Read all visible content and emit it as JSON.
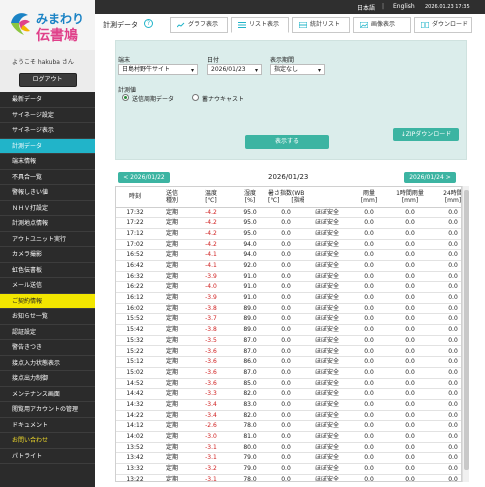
{
  "topbar": {
    "lang_ja": "日本語",
    "sep": "|",
    "lang_en": "English",
    "datetime": "2026.01.23 17:35"
  },
  "logo": {
    "line1": "みまわり",
    "line2": "伝書鳩"
  },
  "user": {
    "welcome": "ようこそ hakuba さん",
    "logout": "ログアウト"
  },
  "menu": [
    {
      "label": "最新データ",
      "state": ""
    },
    {
      "label": "サイネージ設定",
      "state": ""
    },
    {
      "label": "サイネージ表示",
      "state": ""
    },
    {
      "label": "計測データ",
      "state": "active"
    },
    {
      "label": "端末情報",
      "state": ""
    },
    {
      "label": "不具合一覧",
      "state": ""
    },
    {
      "label": "警報しきい値",
      "state": ""
    },
    {
      "label": "ＮＨＶ打設定",
      "state": ""
    },
    {
      "label": "計測地点情報",
      "state": ""
    },
    {
      "label": "アウトユニット実行",
      "state": ""
    },
    {
      "label": "カメラ撮影",
      "state": ""
    },
    {
      "label": "虹色伝書板",
      "state": ""
    },
    {
      "label": "メール送信",
      "state": ""
    },
    {
      "label": "ご契約情報",
      "state": "hl"
    },
    {
      "label": "お知らせ一覧",
      "state": ""
    },
    {
      "label": "認証設定",
      "state": ""
    },
    {
      "label": "警告きつき",
      "state": ""
    },
    {
      "label": "接点入力状態表示",
      "state": ""
    },
    {
      "label": "接点出力制御",
      "state": ""
    },
    {
      "label": "メンテナンス画面",
      "state": ""
    },
    {
      "label": "閲覧用アカウントの管理",
      "state": ""
    },
    {
      "label": "ドキュメント",
      "state": ""
    },
    {
      "label": "お問い合わせ",
      "state": "footer"
    },
    {
      "label": "パトライト",
      "state": ""
    }
  ],
  "page": {
    "title": "計測データ",
    "help": "?"
  },
  "tabs": [
    {
      "label": "グラフ表示",
      "icon": "chart-icon"
    },
    {
      "label": "リスト表示",
      "icon": "list-icon"
    },
    {
      "label": "統計リスト",
      "icon": "stats-icon"
    },
    {
      "label": "画像表示",
      "icon": "image-icon"
    },
    {
      "label": "ダウンロード",
      "icon": "download-icon"
    }
  ],
  "filters": {
    "device_label": "端末",
    "device_value": "日島村野牛サイト",
    "date_label": "日付",
    "date_value": "2026/01/23",
    "period_label": "表示期間",
    "period_value": "指定なし",
    "method_label": "計測値",
    "method_opt1": "送信周期データ",
    "method_opt2": "蓄ナウキャスト",
    "show_button": "表示する",
    "zip_button": "↓ZIPダウンロード"
  },
  "nav": {
    "prev": "< 2026/01/22",
    "current": "2026/01/23",
    "next": "2026/01/24 >"
  },
  "table": {
    "headers": [
      [
        "時刻"
      ],
      [
        "送信",
        "種別"
      ],
      [
        "温度",
        "[℃]"
      ],
      [
        "湿度",
        "[%]"
      ],
      [
        "暑さ指数(WBGT)",
        "[℃]　　[指標]"
      ],
      [
        "",
        ""
      ],
      [
        "雨量",
        "[mm]"
      ],
      [
        "1時間雨量",
        "[mm]"
      ],
      [
        "24時間",
        "[mm]"
      ]
    ],
    "rows": [
      [
        "17:32",
        "定期",
        "-4.2",
        "95.0",
        "0.0",
        "ほぼ安全",
        "0.0",
        "0.0",
        "0.0"
      ],
      [
        "17:22",
        "定期",
        "-4.2",
        "95.0",
        "0.0",
        "ほぼ安全",
        "0.0",
        "0.0",
        "0.0"
      ],
      [
        "17:12",
        "定期",
        "-4.2",
        "95.0",
        "0.0",
        "ほぼ安全",
        "0.0",
        "0.0",
        "0.0"
      ],
      [
        "17:02",
        "定期",
        "-4.2",
        "94.0",
        "0.0",
        "ほぼ安全",
        "0.0",
        "0.0",
        "0.0"
      ],
      [
        "16:52",
        "定期",
        "-4.1",
        "94.0",
        "0.0",
        "ほぼ安全",
        "0.0",
        "0.0",
        "0.0"
      ],
      [
        "16:42",
        "定期",
        "-4.1",
        "92.0",
        "0.0",
        "ほぼ安全",
        "0.0",
        "0.0",
        "0.0"
      ],
      [
        "16:32",
        "定期",
        "-3.9",
        "91.0",
        "0.0",
        "ほぼ安全",
        "0.0",
        "0.0",
        "0.0"
      ],
      [
        "16:22",
        "定期",
        "-4.0",
        "91.0",
        "0.0",
        "ほぼ安全",
        "0.0",
        "0.0",
        "0.0"
      ],
      [
        "16:12",
        "定期",
        "-3.9",
        "91.0",
        "0.0",
        "ほぼ安全",
        "0.0",
        "0.0",
        "0.0"
      ],
      [
        "16:02",
        "定期",
        "-3.8",
        "89.0",
        "0.0",
        "ほぼ安全",
        "0.0",
        "0.0",
        "0.0"
      ],
      [
        "15:52",
        "定期",
        "-3.7",
        "89.0",
        "0.0",
        "ほぼ安全",
        "0.0",
        "0.0",
        "0.0"
      ],
      [
        "15:42",
        "定期",
        "-3.8",
        "89.0",
        "0.0",
        "ほぼ安全",
        "0.0",
        "0.0",
        "0.0"
      ],
      [
        "15:32",
        "定期",
        "-3.5",
        "87.0",
        "0.0",
        "ほぼ安全",
        "0.0",
        "0.0",
        "0.0"
      ],
      [
        "15:22",
        "定期",
        "-3.6",
        "87.0",
        "0.0",
        "ほぼ安全",
        "0.0",
        "0.0",
        "0.0"
      ],
      [
        "15:12",
        "定期",
        "-3.6",
        "86.0",
        "0.0",
        "ほぼ安全",
        "0.0",
        "0.0",
        "0.0"
      ],
      [
        "15:02",
        "定期",
        "-3.6",
        "87.0",
        "0.0",
        "ほぼ安全",
        "0.0",
        "0.0",
        "0.0"
      ],
      [
        "14:52",
        "定期",
        "-3.6",
        "85.0",
        "0.0",
        "ほぼ安全",
        "0.0",
        "0.0",
        "0.0"
      ],
      [
        "14:42",
        "定期",
        "-3.3",
        "82.0",
        "0.0",
        "ほぼ安全",
        "0.0",
        "0.0",
        "0.0"
      ],
      [
        "14:32",
        "定期",
        "-3.4",
        "83.0",
        "0.0",
        "ほぼ安全",
        "0.0",
        "0.0",
        "0.0"
      ],
      [
        "14:22",
        "定期",
        "-3.4",
        "82.0",
        "0.0",
        "ほぼ安全",
        "0.0",
        "0.0",
        "0.0"
      ],
      [
        "14:12",
        "定期",
        "-2.6",
        "78.0",
        "0.0",
        "ほぼ安全",
        "0.0",
        "0.0",
        "0.0"
      ],
      [
        "14:02",
        "定期",
        "-3.0",
        "81.0",
        "0.0",
        "ほぼ安全",
        "0.0",
        "0.0",
        "0.0"
      ],
      [
        "13:52",
        "定期",
        "-3.1",
        "80.0",
        "0.0",
        "ほぼ安全",
        "0.0",
        "0.0",
        "0.0"
      ],
      [
        "13:42",
        "定期",
        "-3.1",
        "79.0",
        "0.0",
        "ほぼ安全",
        "0.0",
        "0.0",
        "0.0"
      ],
      [
        "13:32",
        "定期",
        "-3.2",
        "79.0",
        "0.0",
        "ほぼ安全",
        "0.0",
        "0.0",
        "0.0"
      ],
      [
        "13:22",
        "定期",
        "-3.1",
        "78.0",
        "0.0",
        "ほぼ安全",
        "0.0",
        "0.0",
        "0.0"
      ]
    ]
  },
  "colors": {
    "accent": "#21b4c9",
    "button": "#3cb4a2",
    "highlight": "#f2e600",
    "temp": "#d02020"
  }
}
